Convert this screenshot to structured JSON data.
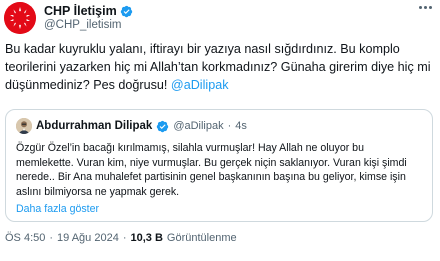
{
  "author": {
    "name": "CHP İletişim",
    "handle": "@CHP_iletisim"
  },
  "tweet": {
    "text_main": "Bu kadar kuyruklu yalanı, iftirayı bir yazıya nasıl sığdırdınız. Bu komplo teorilerini yazarken hiç mi Allah’tan korkmadınız? Günaha girerim diye hiç mi düşünmediniz? Pes doğrusu! ",
    "mention": "@aDilipak"
  },
  "quote": {
    "name": "Abdurrahman Dilipak",
    "handle": "@aDilipak",
    "dot": "·",
    "time": "4s",
    "text": "Özgür Özel’in bacağı kırılmamış, silahla vurmuşlar! Hay Allah ne oluyor bu memlekette. Vuran kim, niye vurmuşlar. Bu gerçek niçin saklanıyor. Vuran kişi şimdi nerede.. Bir Ana muhalefet partisinin genel başkanının başına bu geliyor, kimse işin aslını bilmiyorsa ne yapmak gerek.",
    "show_more": "Daha fazla göster"
  },
  "meta": {
    "time": "ÖS 4:50",
    "sep1": "·",
    "date": "19 Ağu 2024",
    "sep2": "·",
    "views": "10,3 B",
    "views_label": "Görüntülenme"
  },
  "colors": {
    "link": "#1d9bf0",
    "verified": "#1d9bf0",
    "brand_red": "#e30a17",
    "secondary_text": "#536471"
  }
}
